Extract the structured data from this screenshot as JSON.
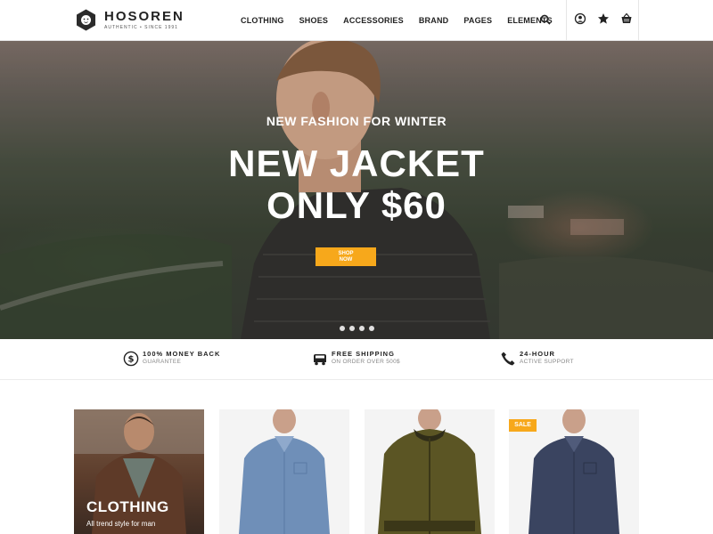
{
  "header": {
    "brand": "HOSOREN",
    "tagline": "AUTHENTIC • SINCE 1991",
    "nav": [
      "CLOTHING",
      "SHOES",
      "ACCESSORIES",
      "BRAND",
      "PAGES",
      "ELEMENTS"
    ],
    "icons": [
      "search-icon",
      "account-icon",
      "star-icon",
      "basket-icon"
    ]
  },
  "hero": {
    "subtitle": "NEW FASHION FOR WINTER",
    "title_line1": "NEW JACKET",
    "title_line2": "ONLY $60",
    "button_line1": "SHOP",
    "button_line2": "NOW",
    "slide_count": 4,
    "button_color": "#f7a81b"
  },
  "features": [
    {
      "icon": "dollar-icon",
      "title": "100% MONEY BACK",
      "subtitle": "GUARANTEE"
    },
    {
      "icon": "truck-icon",
      "title": "FREE SHIPPING",
      "subtitle": "ON ORDER OVER 500$"
    },
    {
      "icon": "phone-icon",
      "title": "24-HOUR",
      "subtitle": "ACTIVE SUPPORT"
    }
  ],
  "products": {
    "category_title": "CLOTHING",
    "category_subtitle": "All trend style for man",
    "sale_badge": "SALE",
    "accent_color": "#f7a81b"
  }
}
